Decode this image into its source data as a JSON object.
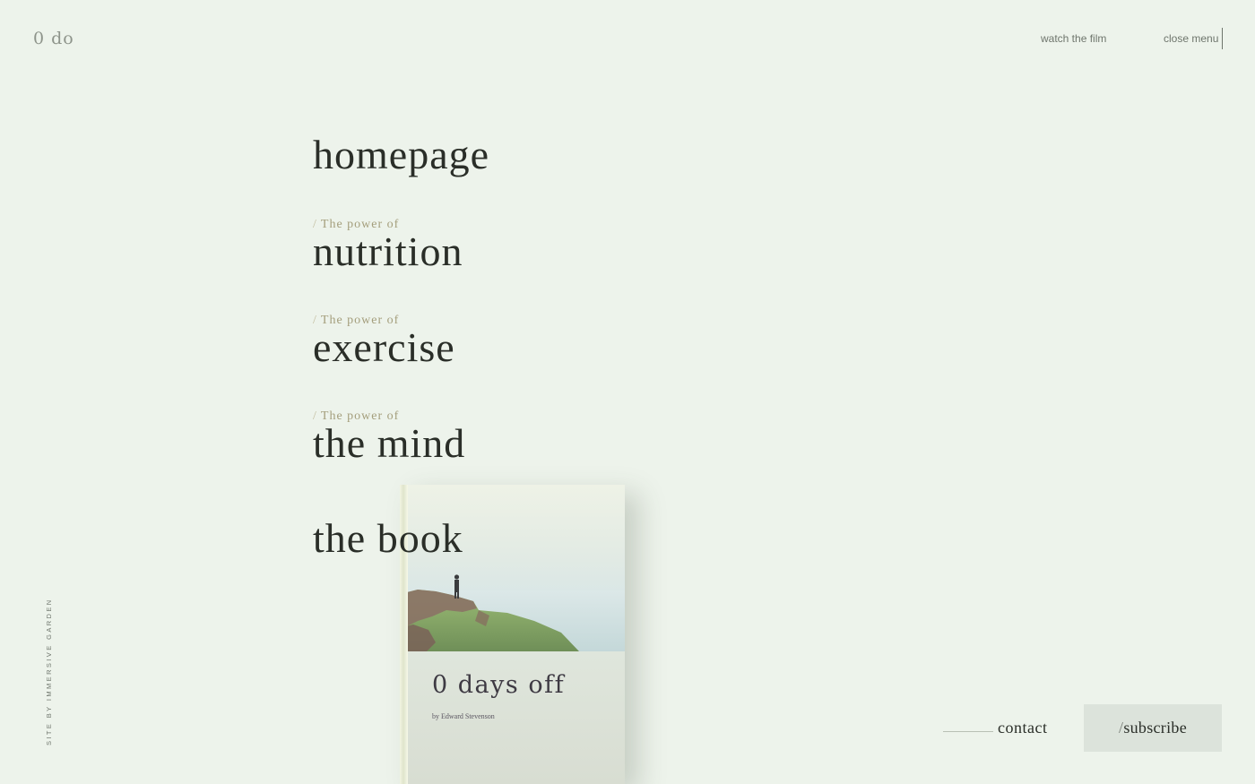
{
  "header": {
    "logo": "0 do",
    "watch_film": "watch the film",
    "close_menu": "close menu"
  },
  "menu": {
    "items": [
      {
        "prefix": "",
        "label": "homepage"
      },
      {
        "prefix": "The power of",
        "label": "nutrition"
      },
      {
        "prefix": "The power of",
        "label": "exercise"
      },
      {
        "prefix": "The power of",
        "label": "the mind"
      },
      {
        "prefix": "",
        "label": "the book"
      }
    ]
  },
  "book": {
    "title": "0 days off",
    "author": "by Edward Stevenson"
  },
  "footer": {
    "credit": "SITE BY IMMERSIVE GARDEN",
    "contact": "contact",
    "subscribe": "subscribe"
  },
  "colors": {
    "background": "#edf3eb",
    "text": "#2a2e28",
    "accent_olive": "#a49e7c",
    "subscribe_bg": "#dce3db"
  }
}
